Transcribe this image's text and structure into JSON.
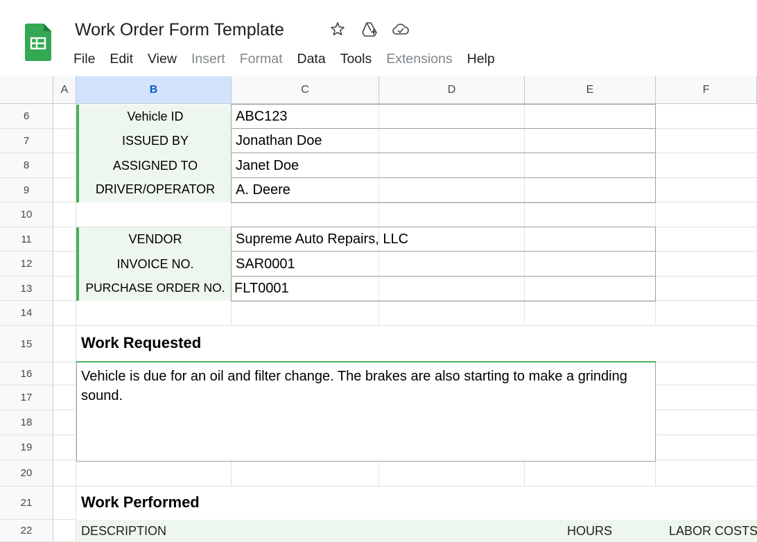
{
  "app": {
    "title": "Work Order Form Template",
    "menu": [
      {
        "label": "File",
        "enabled": true
      },
      {
        "label": "Edit",
        "enabled": true
      },
      {
        "label": "View",
        "enabled": true
      },
      {
        "label": "Insert",
        "enabled": false
      },
      {
        "label": "Format",
        "enabled": false
      },
      {
        "label": "Data",
        "enabled": true
      },
      {
        "label": "Tools",
        "enabled": true
      },
      {
        "label": "Extensions",
        "enabled": false
      },
      {
        "label": "Help",
        "enabled": true
      }
    ],
    "icons": [
      "star-icon",
      "move-to-drive-icon",
      "cloud-saved-icon"
    ],
    "logo_color": "#34a853",
    "accent": "#4caf5e"
  },
  "columns": [
    "A",
    "B",
    "C",
    "D",
    "E",
    "F"
  ],
  "selected_column": "B",
  "rows": [
    "6",
    "7",
    "8",
    "9",
    "10",
    "11",
    "12",
    "13",
    "14",
    "15",
    "16",
    "17",
    "18",
    "19",
    "20",
    "21",
    "22"
  ],
  "fields": {
    "vehicle_id": {
      "label": "Vehicle ID",
      "value": "ABC123"
    },
    "issued_by": {
      "label": "ISSUED BY",
      "value": "Jonathan Doe"
    },
    "assigned_to": {
      "label": "ASSIGNED TO",
      "value": "Janet Doe"
    },
    "driver": {
      "label": "DRIVER/OPERATOR",
      "value": "A. Deere"
    },
    "vendor": {
      "label": "VENDOR",
      "value": "Supreme Auto Repairs, LLC"
    },
    "invoice": {
      "label": "INVOICE NO.",
      "value": "SAR0001"
    },
    "po": {
      "label": "PURCHASE ORDER NO.",
      "value": "FLT0001"
    }
  },
  "work_requested": {
    "title": "Work Requested",
    "text": "Vehicle is due for an oil and filter change. The brakes are also starting to make a grinding sound."
  },
  "work_performed": {
    "title": "Work Performed",
    "columns": [
      "DESCRIPTION",
      "HOURS",
      "LABOR COSTS"
    ]
  }
}
